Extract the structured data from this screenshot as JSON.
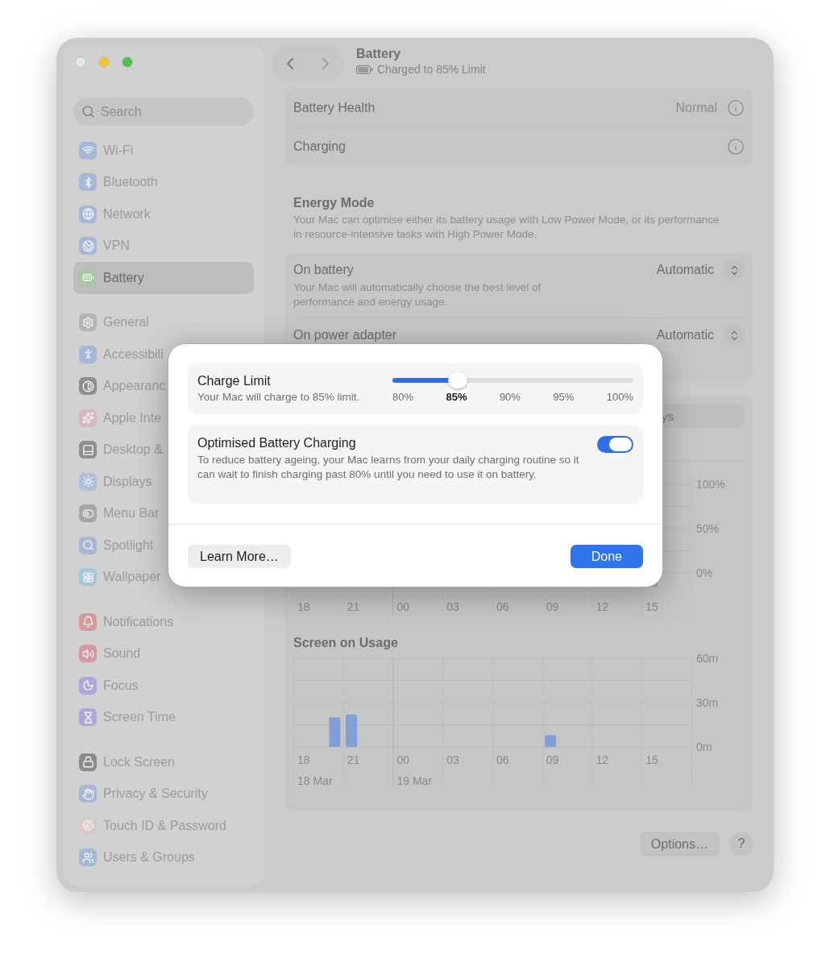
{
  "window": {
    "controls": [
      {
        "color": "#e6e6e6"
      },
      {
        "color": "#f2c230"
      },
      {
        "color": "#52bf4f"
      }
    ]
  },
  "sidebar": {
    "search": {
      "placeholder": "Search"
    },
    "groups": [
      {
        "items": [
          {
            "label": "Wi-Fi",
            "color": "#a6b8d6",
            "selected": false
          },
          {
            "label": "Bluetooth",
            "color": "#a6b8d6",
            "selected": false
          },
          {
            "label": "Network",
            "color": "#a6b8d6",
            "selected": false
          },
          {
            "label": "VPN",
            "color": "#a6b8d6",
            "selected": false
          },
          {
            "label": "Battery",
            "color": "#a8c6a4",
            "selected": true
          }
        ]
      },
      {
        "items": [
          {
            "label": "General",
            "color": "#b4b4b4",
            "selected": false
          },
          {
            "label": "Accessibili",
            "color": "#a6b8d6",
            "selected": false
          },
          {
            "label": "Appearanc",
            "color": "#8e8e8e",
            "selected": false
          },
          {
            "label": "Apple Inte",
            "color": "#d4b8c4",
            "selected": false
          },
          {
            "label": "Desktop &",
            "color": "#8e8e8e",
            "selected": false
          },
          {
            "label": "Displays",
            "color": "#aec0dc",
            "selected": false
          },
          {
            "label": "Menu Bar",
            "color": "#a6a6a6",
            "selected": false
          },
          {
            "label": "Spotlight",
            "color": "#a6b8d6",
            "selected": false
          },
          {
            "label": "Wallpaper",
            "color": "#a6c8d4",
            "selected": false
          }
        ]
      },
      {
        "items": [
          {
            "label": "Notifications",
            "color": "#d49a9a",
            "selected": false
          },
          {
            "label": "Sound",
            "color": "#d49aa4",
            "selected": false
          },
          {
            "label": "Focus",
            "color": "#aea8d8",
            "selected": false
          },
          {
            "label": "Screen Time",
            "color": "#aea8d8",
            "selected": false
          }
        ]
      },
      {
        "items": [
          {
            "label": "Lock Screen",
            "color": "#8a8a8a",
            "selected": false
          },
          {
            "label": "Privacy & Security",
            "color": "#a6b8d6",
            "selected": false
          },
          {
            "label": "Touch ID & Password",
            "color": "#d8c8c8",
            "selected": false
          },
          {
            "label": "Users & Groups",
            "color": "#a6b8d6",
            "selected": false
          }
        ]
      }
    ]
  },
  "header": {
    "title": "Battery",
    "subtitle": "Charged to 85% Limit"
  },
  "health_card": {
    "rows": [
      {
        "label": "Battery Health",
        "value": "Normal"
      },
      {
        "label": "Charging"
      }
    ]
  },
  "energy_mode": {
    "title": "Energy Mode",
    "description": "Your Mac can optimise either its battery usage with Low Power Mode, or its performance in resource-intensive tasks with High Power Mode.",
    "rows": [
      {
        "label": "On battery",
        "description": "Your Mac will automatically choose the best level of performance and energy usage.",
        "value": "Automatic"
      },
      {
        "label": "On power adapter",
        "value": "Automatic"
      }
    ]
  },
  "usage_card": {
    "segment": {
      "label": "ys"
    },
    "battery_chart": {
      "y_labels": [
        "100%",
        "50%",
        "0%"
      ],
      "x_labels": [
        "18",
        "21",
        "00",
        "03",
        "06",
        "09",
        "12",
        "15"
      ]
    },
    "screen_usage": {
      "title": "Screen on Usage",
      "date_labels": [
        "18 Mar",
        "19 Mar"
      ],
      "chart_data": {
        "type": "bar",
        "categories": [
          "18",
          null,
          null,
          "21",
          null,
          null,
          "00",
          null,
          null,
          "03",
          null,
          null,
          "06",
          null,
          null,
          "09",
          null,
          null,
          "12",
          null,
          null,
          "15",
          null,
          null
        ],
        "values": [
          0,
          0,
          20,
          22,
          0,
          0,
          0,
          0,
          0,
          0,
          0,
          0,
          0,
          0,
          0,
          8,
          0,
          0,
          0,
          0,
          0,
          0,
          0,
          0
        ],
        "ylim": [
          0,
          60
        ],
        "yticks": [
          {
            "value": 0,
            "label": "0m"
          },
          {
            "value": 30,
            "label": "30m"
          },
          {
            "value": 60,
            "label": "60m"
          }
        ]
      }
    }
  },
  "footer": {
    "options": "Options…",
    "help": "?"
  },
  "dialog": {
    "charge_limit": {
      "title": "Charge Limit",
      "description": "Your Mac will charge to 85% limit.",
      "level": 0.27,
      "ticks": [
        {
          "label": "80%",
          "selected": false
        },
        {
          "label": "85%",
          "selected": true
        },
        {
          "label": "90%",
          "selected": false
        },
        {
          "label": "95%",
          "selected": false
        },
        {
          "label": "100%",
          "selected": false
        }
      ]
    },
    "optimised": {
      "title": "Optimised Battery Charging",
      "description": "To reduce battery ageing, your Mac learns from your daily charging routine so it can wait to finish charging past 80% until you need to use it on battery.",
      "on": true
    },
    "buttons": [
      {
        "kind": "secondary",
        "label": "Learn More…"
      },
      {
        "kind": "primary",
        "label": "Done"
      }
    ]
  }
}
